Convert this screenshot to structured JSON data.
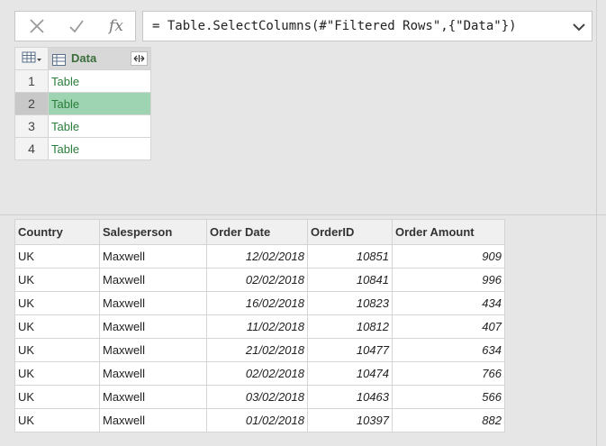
{
  "formula_bar": {
    "formula": "= Table.SelectColumns(#\"Filtered Rows\",{\"Data\"})",
    "fx_label": "fx"
  },
  "upper_grid": {
    "column_header": "Data",
    "rows": [
      {
        "index": "1",
        "value": "Table"
      },
      {
        "index": "2",
        "value": "Table"
      },
      {
        "index": "3",
        "value": "Table"
      },
      {
        "index": "4",
        "value": "Table"
      }
    ],
    "selected_row": 2
  },
  "preview_table": {
    "headers": [
      "Country",
      "Salesperson",
      "Order Date",
      "OrderID",
      "Order Amount"
    ],
    "rows": [
      [
        "UK",
        "Maxwell",
        "12/02/2018",
        "10851",
        "909"
      ],
      [
        "UK",
        "Maxwell",
        "02/02/2018",
        "10841",
        "996"
      ],
      [
        "UK",
        "Maxwell",
        "16/02/2018",
        "10823",
        "434"
      ],
      [
        "UK",
        "Maxwell",
        "11/02/2018",
        "10812",
        "407"
      ],
      [
        "UK",
        "Maxwell",
        "21/02/2018",
        "10477",
        "634"
      ],
      [
        "UK",
        "Maxwell",
        "02/02/2018",
        "10474",
        "766"
      ],
      [
        "UK",
        "Maxwell",
        "03/02/2018",
        "10463",
        "566"
      ],
      [
        "UK",
        "Maxwell",
        "01/02/2018",
        "10397",
        "882"
      ]
    ]
  },
  "colors": {
    "selected_cell": "#9fd4b2",
    "table_value_text": "#2a7d3a",
    "header_text": "#3b6e3b"
  },
  "icons": [
    "cancel-icon",
    "checkmark-icon",
    "fx-icon",
    "chevron-down-icon",
    "table-menu-icon",
    "table-column-icon",
    "expand-column-icon"
  ]
}
